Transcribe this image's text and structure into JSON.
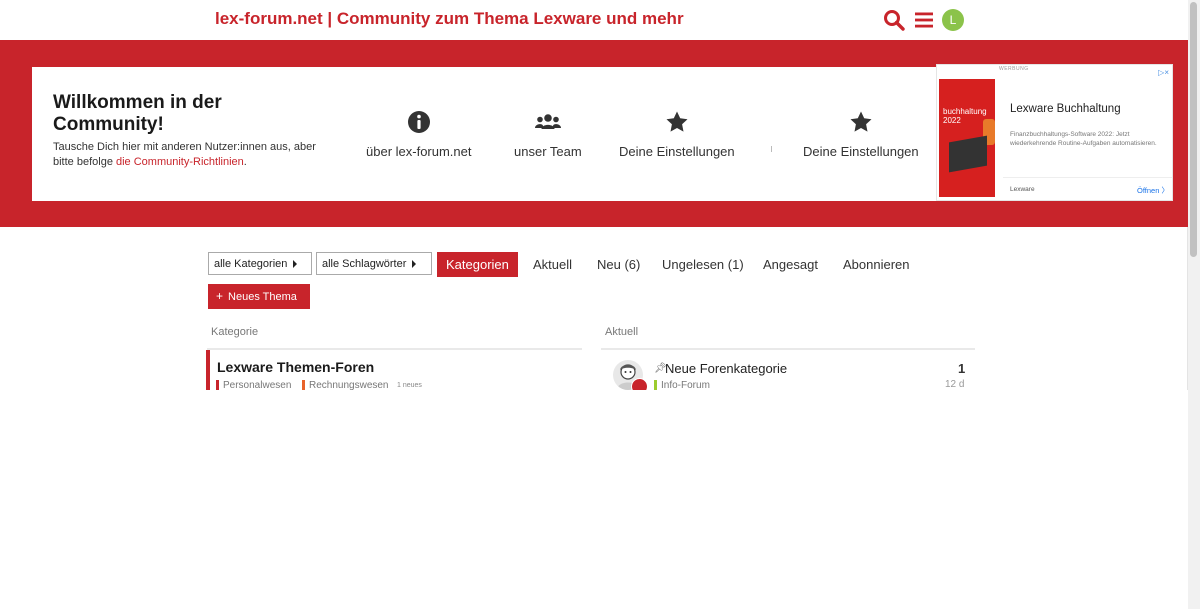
{
  "header": {
    "site_title": "lex-forum.net | Community zum Thema Lexware und mehr",
    "avatar_letter": "L",
    "icons": [
      "search-icon",
      "hamburger-menu-icon",
      "user-avatar"
    ]
  },
  "welcome": {
    "title": "Willkommen in der Community!",
    "text": "Tausche Dich hier mit anderen Nutzer:innen aus, aber bitte befolge ",
    "link": "die Community-Richtlinien",
    "text_end": "."
  },
  "quick_links": [
    {
      "label": "über lex-forum.net",
      "icon": "info-icon"
    },
    {
      "label": "unser Team",
      "icon": "users-icon"
    },
    {
      "label": "Deine Einstellungen",
      "icon": "star-icon"
    },
    {
      "label": "Deine Einstellungen",
      "icon": "star-icon"
    }
  ],
  "ad": {
    "tag": "WERBUNG",
    "box_label": "buchhaltung 2022",
    "headline": "Lexware Buchhaltung",
    "description": "Finanzbuchhaltungs-Software 2022: Jetzt wiederkehrende Routine-Aufgaben automatisieren.",
    "brand": "Lexware",
    "cta": "Öffnen"
  },
  "nav": {
    "dropdowns": [
      "alle Kategorien",
      "alle Schlagwörter"
    ],
    "tabs": [
      "Kategorien",
      "Aktuell",
      "Neu (6)",
      "Ungelesen (1)",
      "Angesagt",
      "Abonnieren"
    ],
    "active_tab": "Kategorien",
    "new_topic": "Neues Thema"
  },
  "categories": {
    "header": "Kategorie",
    "items": [
      {
        "title": "Lexware Themen-Foren",
        "subcategories": [
          "Personalwesen",
          "Rechnungswesen"
        ],
        "new_label": "1 neues"
      }
    ]
  },
  "latest": {
    "header": "Aktuell",
    "items": [
      {
        "title": "Neue Forenkategorie",
        "category": "Info-Forum",
        "count": "1",
        "age": "12 d"
      }
    ]
  },
  "colors": {
    "brand_red": "#c8242b",
    "subcat_personal": "#c8242b",
    "subcat_rechnung": "#e8632b",
    "info_forum": "#9ccc2e"
  }
}
